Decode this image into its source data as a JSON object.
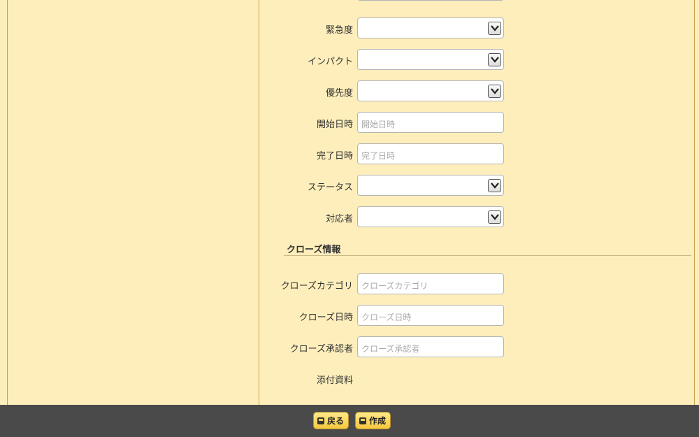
{
  "fields": [
    {
      "label": "",
      "type": "select",
      "value": ""
    },
    {
      "label": "緊急度",
      "type": "select",
      "value": ""
    },
    {
      "label": "インパクト",
      "type": "select",
      "value": ""
    },
    {
      "label": "優先度",
      "type": "select",
      "value": ""
    },
    {
      "label": "開始日時",
      "type": "input",
      "placeholder": "開始日時"
    },
    {
      "label": "完了日時",
      "type": "input",
      "placeholder": "完了日時"
    },
    {
      "label": "ステータス",
      "type": "select",
      "value": ""
    },
    {
      "label": "対応者",
      "type": "select",
      "value": ""
    }
  ],
  "close_section": {
    "title": "クローズ情報",
    "fields": [
      {
        "label": "クローズカテゴリ",
        "placeholder": "クローズカテゴリ"
      },
      {
        "label": "クローズ日時",
        "placeholder": "クローズ日時"
      },
      {
        "label": "クローズ承認者",
        "placeholder": "クローズ承認者"
      }
    ],
    "attachment_label": "添付資料"
  },
  "footer": {
    "back_label": "戻る",
    "create_label": "作成"
  },
  "colors": {
    "background": "#fdeebb",
    "footer": "#4a4a4a",
    "button": "#f5c83c"
  }
}
